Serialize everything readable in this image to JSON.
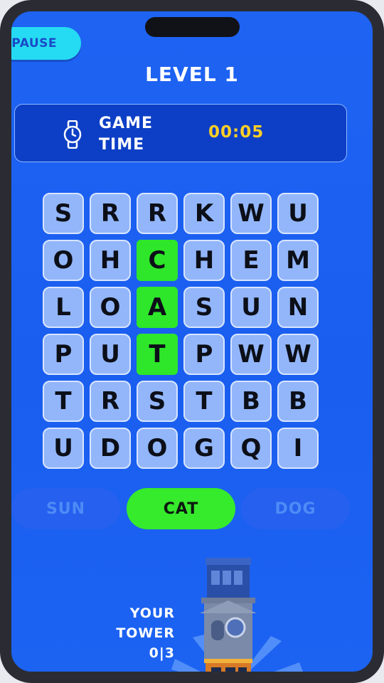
{
  "pause_label": "PAUSE",
  "level_title": "LEVEL 1",
  "timer": {
    "label_line1": "GAME",
    "label_line2": "TIME",
    "value": "00:05",
    "icon": "watch-icon",
    "value_color": "#ffcf26"
  },
  "grid": {
    "rows": [
      [
        "S",
        "R",
        "R",
        "K",
        "W",
        "U"
      ],
      [
        "O",
        "H",
        "C",
        "H",
        "E",
        "M"
      ],
      [
        "L",
        "O",
        "A",
        "S",
        "U",
        "N"
      ],
      [
        "P",
        "U",
        "T",
        "P",
        "W",
        "W"
      ],
      [
        "T",
        "R",
        "S",
        "T",
        "B",
        "B"
      ],
      [
        "U",
        "D",
        "O",
        "G",
        "Q",
        "I"
      ]
    ],
    "highlight_color": "#2ee62a"
  },
  "words": [
    {
      "text": "SUN",
      "found": false
    },
    {
      "text": "CAT",
      "found": true
    },
    {
      "text": "DOG",
      "found": false
    }
  ],
  "tower": {
    "line1": "YOUR",
    "line2": "TOWER",
    "progress": "0|3"
  }
}
